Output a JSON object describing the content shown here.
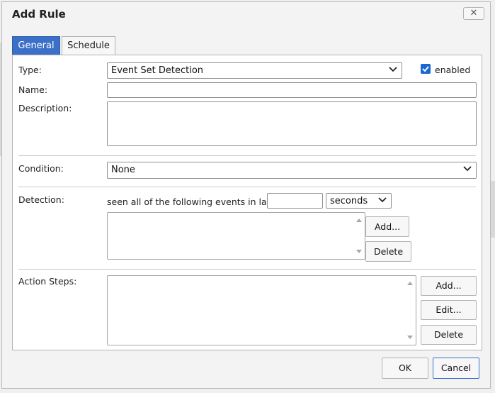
{
  "dialog": {
    "title": "Add Rule",
    "close_label": "✕"
  },
  "tabs": [
    {
      "label": "General",
      "active": true
    },
    {
      "label": "Schedule",
      "active": false
    }
  ],
  "general": {
    "type_label": "Type:",
    "type_value": "Event Set Detection",
    "enabled_label": "enabled",
    "enabled_checked": true,
    "name_label": "Name:",
    "name_value": "",
    "description_label": "Description:",
    "description_value": "",
    "condition_label": "Condition:",
    "condition_value": "None",
    "detection_label": "Detection:",
    "detection_text": "seen all of the following events in last",
    "detection_time_value": "",
    "detection_unit": "seconds",
    "detection_add_label": "Add...",
    "detection_delete_label": "Delete",
    "action_steps_label": "Action Steps:",
    "action_add_label": "Add...",
    "action_edit_label": "Edit...",
    "action_delete_label": "Delete"
  },
  "footer": {
    "ok_label": "OK",
    "cancel_label": "Cancel"
  },
  "colors": {
    "accent": "#3b70c9",
    "checkbox": "#1a66d2"
  }
}
